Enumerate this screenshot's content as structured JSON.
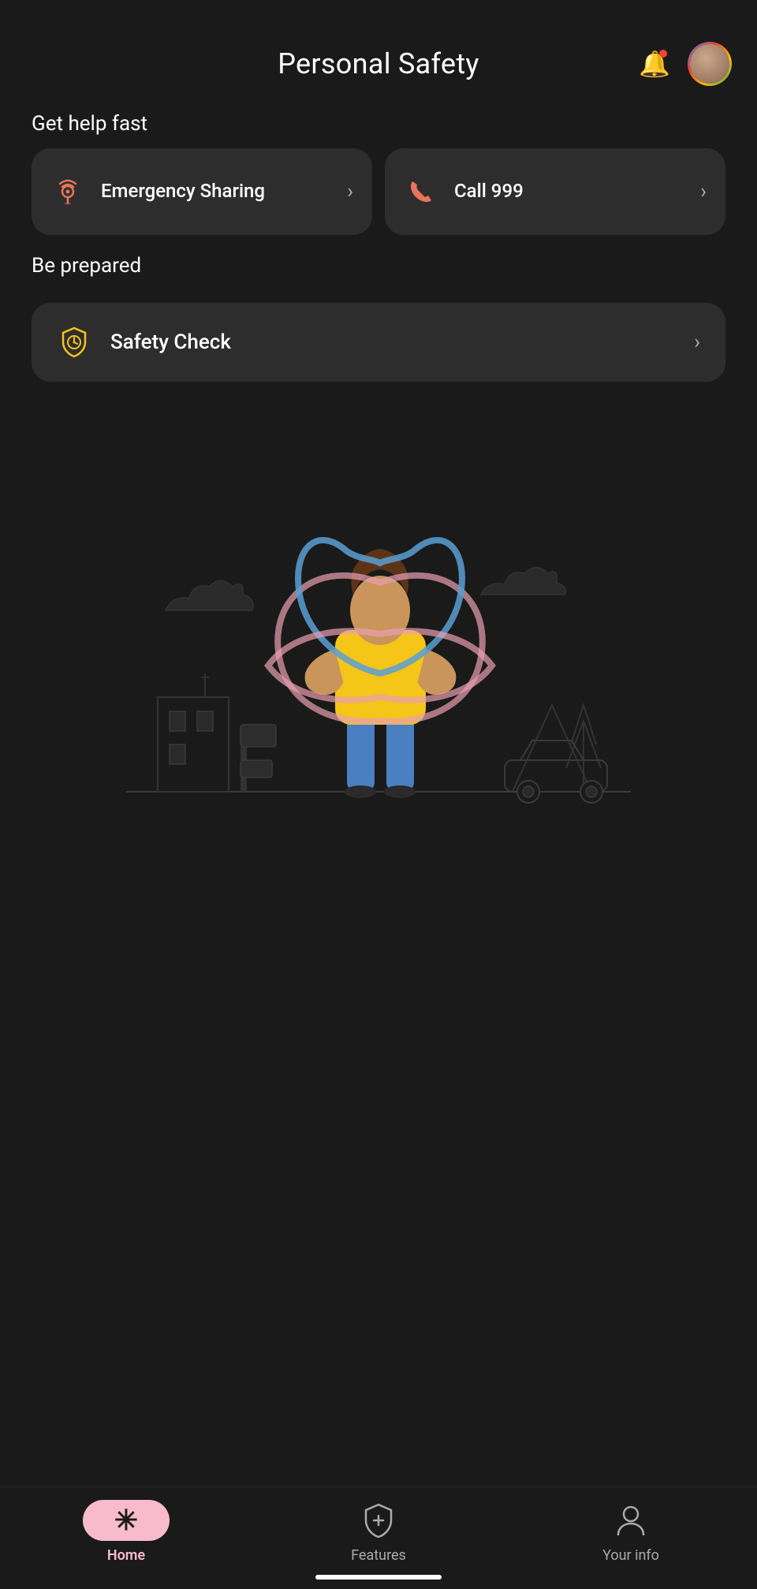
{
  "header": {
    "title": "Personal Safety",
    "bell_label": "notifications",
    "avatar_label": "user avatar"
  },
  "sections": {
    "get_help_fast": {
      "label": "Get help fast",
      "emergency_sharing": {
        "text": "Emergency Sharing",
        "icon": "location-wifi-icon"
      },
      "call_999": {
        "text": "Call 999",
        "icon": "phone-icon"
      }
    },
    "be_prepared": {
      "label": "Be prepared",
      "safety_check": {
        "text": "Safety Check",
        "icon": "shield-clock-icon"
      }
    }
  },
  "bottom_nav": {
    "home": {
      "label": "Home",
      "icon": "asterisk-icon",
      "active": true
    },
    "features": {
      "label": "Features",
      "icon": "shield-plus-icon",
      "active": false
    },
    "your_info": {
      "label": "Your info",
      "icon": "person-icon",
      "active": false
    }
  },
  "colors": {
    "background": "#1a1a1a",
    "card_bg": "#2d2d2d",
    "accent_emergency": "#e8735a",
    "accent_phone": "#e8735a",
    "accent_shield": "#f5c518",
    "home_pill": "#f8bbcc",
    "active_label": "#f8bbcc"
  }
}
